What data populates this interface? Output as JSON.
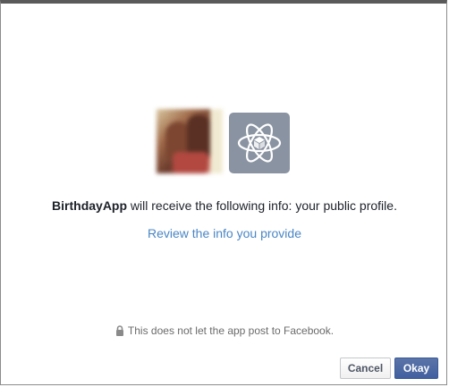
{
  "dialog": {
    "app_name": "BirthdayApp",
    "message_rest": " will receive the following info: your public profile.",
    "review_link": "Review the info you provide",
    "notice": "This does not let the app post to Facebook.",
    "icons": {
      "user_photo": "profile-photo",
      "app": "atom-cube-icon",
      "notice": "lock-icon"
    }
  },
  "buttons": {
    "cancel_label": "Cancel",
    "okay_label": "Okay"
  },
  "colors": {
    "link": "#4a86c5",
    "primary_button": "#4160a0",
    "app_icon_bg": "#8a93a1"
  }
}
